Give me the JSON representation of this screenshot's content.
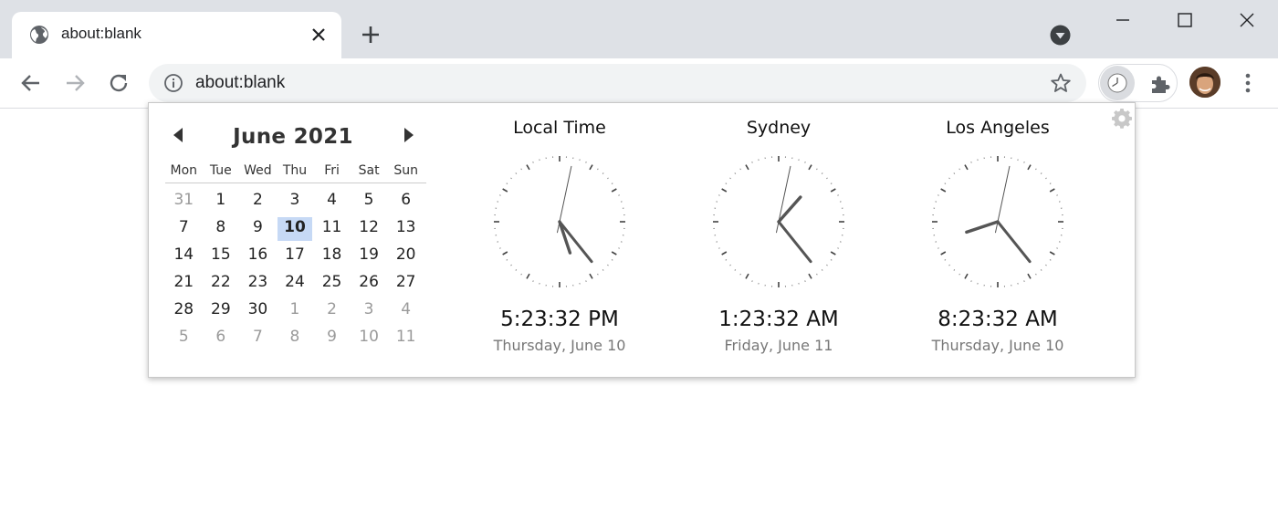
{
  "browser": {
    "tab": {
      "title": "about:blank",
      "favicon": "globe-icon"
    },
    "omnibox": {
      "url": "about:blank"
    },
    "icons": {
      "back": "arrow-left-icon",
      "forward": "arrow-right-icon",
      "reload": "reload-icon",
      "info": "info-icon",
      "bookmark": "star-icon",
      "extension_clock": "clock-icon",
      "extensions": "puzzle-icon",
      "menu": "more-vert-icon"
    }
  },
  "popup": {
    "calendar": {
      "title": "June 2021",
      "weekdays": [
        "Mon",
        "Tue",
        "Wed",
        "Thu",
        "Fri",
        "Sat",
        "Sun"
      ],
      "days": [
        {
          "d": "31",
          "other": true
        },
        {
          "d": "1"
        },
        {
          "d": "2"
        },
        {
          "d": "3"
        },
        {
          "d": "4"
        },
        {
          "d": "5"
        },
        {
          "d": "6"
        },
        {
          "d": "7"
        },
        {
          "d": "8"
        },
        {
          "d": "9"
        },
        {
          "d": "10",
          "today": true
        },
        {
          "d": "11"
        },
        {
          "d": "12"
        },
        {
          "d": "13"
        },
        {
          "d": "14"
        },
        {
          "d": "15"
        },
        {
          "d": "16"
        },
        {
          "d": "17"
        },
        {
          "d": "18"
        },
        {
          "d": "19"
        },
        {
          "d": "20"
        },
        {
          "d": "21"
        },
        {
          "d": "22"
        },
        {
          "d": "23"
        },
        {
          "d": "24"
        },
        {
          "d": "25"
        },
        {
          "d": "26"
        },
        {
          "d": "27"
        },
        {
          "d": "28"
        },
        {
          "d": "29"
        },
        {
          "d": "30"
        },
        {
          "d": "1",
          "other": true
        },
        {
          "d": "2",
          "other": true
        },
        {
          "d": "3",
          "other": true
        },
        {
          "d": "4",
          "other": true
        },
        {
          "d": "5",
          "other": true
        },
        {
          "d": "6",
          "other": true
        },
        {
          "d": "7",
          "other": true
        },
        {
          "d": "8",
          "other": true
        },
        {
          "d": "9",
          "other": true
        },
        {
          "d": "10",
          "other": true
        },
        {
          "d": "11",
          "other": true
        }
      ]
    },
    "clocks": [
      {
        "name": "Local Time",
        "time": "5:23:32 PM",
        "date": "Thursday, June 10",
        "hour": 17,
        "minute": 23,
        "second": 32
      },
      {
        "name": "Sydney",
        "time": "1:23:32 AM",
        "date": "Friday, June 11",
        "hour": 1,
        "minute": 23,
        "second": 32
      },
      {
        "name": "Los Angeles",
        "time": "8:23:32 AM",
        "date": "Thursday, June 10",
        "hour": 8,
        "minute": 23,
        "second": 32
      }
    ]
  },
  "colors": {
    "today_highlight": "#c6d9f5",
    "hand": "#555555"
  }
}
